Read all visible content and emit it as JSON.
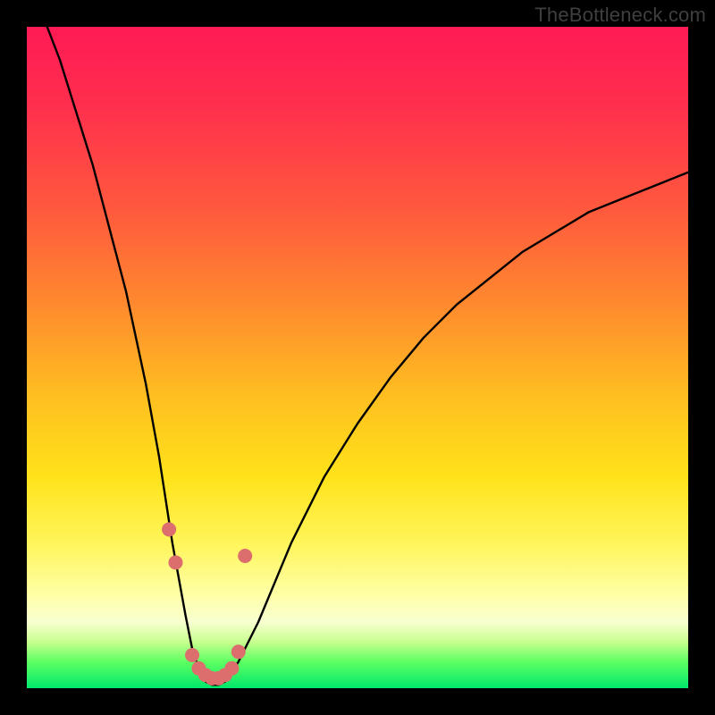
{
  "watermark": "TheBottleneck.com",
  "chart_data": {
    "type": "line",
    "title": "",
    "xlabel": "",
    "ylabel": "",
    "xlim": [
      0,
      100
    ],
    "ylim": [
      0,
      100
    ],
    "series": [
      {
        "name": "bottleneck-curve",
        "x": [
          0,
          5,
          10,
          15,
          18,
          20,
          22,
          24,
          25,
          26,
          27,
          28,
          29,
          30,
          32,
          35,
          40,
          45,
          50,
          55,
          60,
          65,
          70,
          75,
          80,
          85,
          90,
          95,
          100
        ],
        "values": [
          108,
          95,
          79,
          60,
          46,
          35,
          22,
          11,
          6,
          3,
          1,
          0.5,
          0.5,
          1,
          4,
          10,
          22,
          32,
          40,
          47,
          53,
          58,
          62,
          66,
          69,
          72,
          74,
          76,
          78
        ]
      }
    ],
    "markers": {
      "name": "highlight-points",
      "color": "#dd6e6e",
      "x": [
        21.5,
        22.5,
        25.0,
        26.0,
        27.0,
        28.0,
        29.0,
        30.0,
        31.0,
        32.0,
        33.0
      ],
      "values": [
        24.0,
        19.0,
        5.0,
        3.0,
        2.0,
        1.5,
        1.5,
        2.0,
        3.0,
        5.5,
        20.0
      ]
    }
  }
}
